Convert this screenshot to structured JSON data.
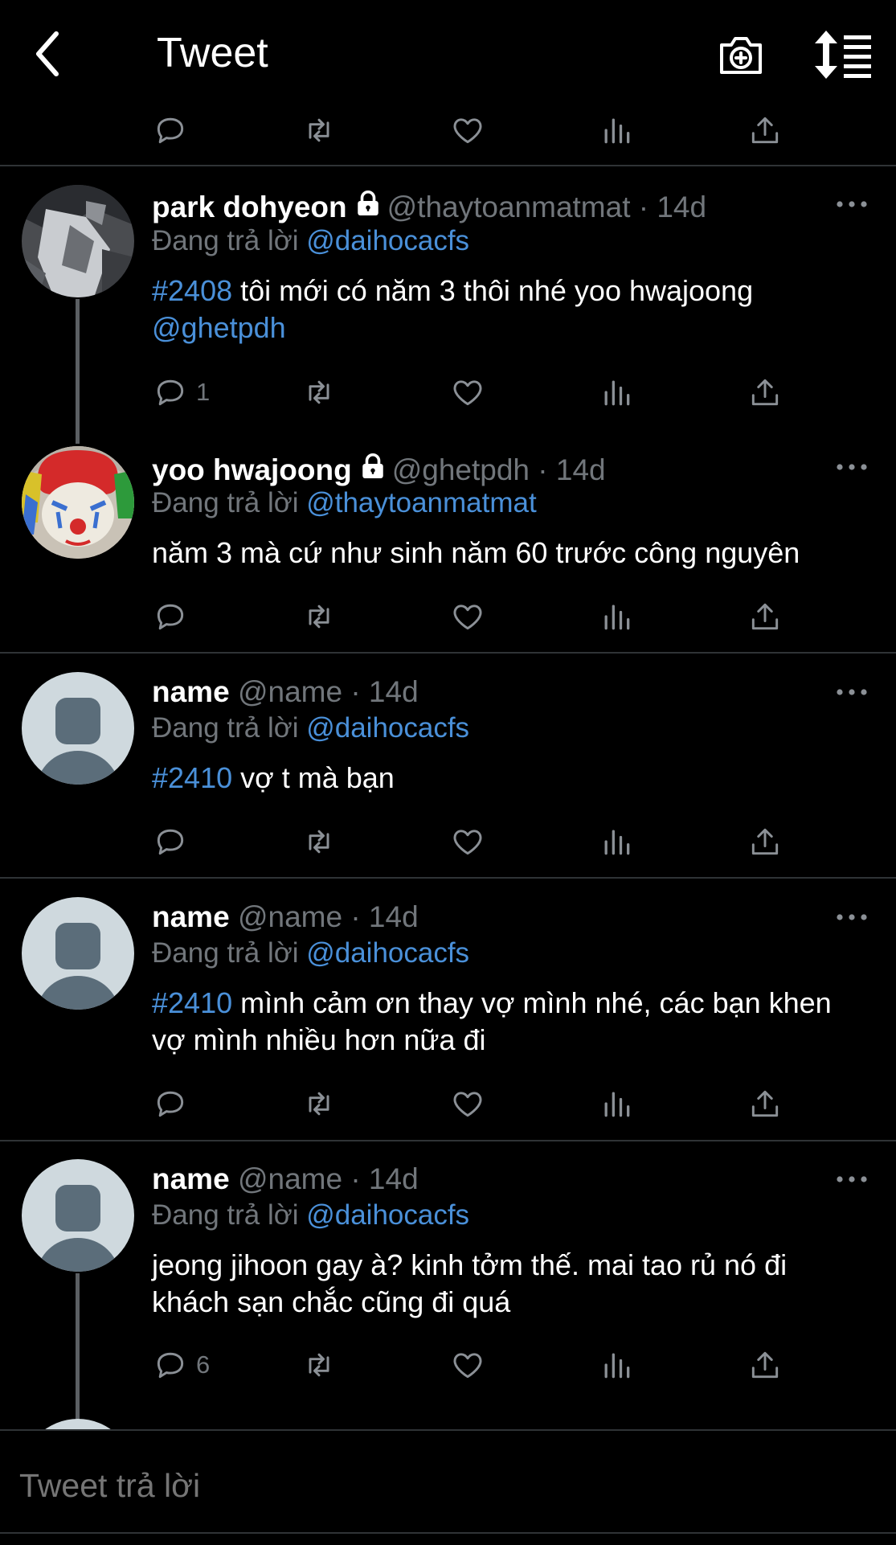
{
  "header": {
    "title": "Tweet"
  },
  "tweets": [
    {
      "name": "park dohyeon",
      "handle_time": "@thaytoanmatmat · 14d",
      "replying_label": "Đang trả lời",
      "replying_to": "@daihocacfs",
      "hashtag": "#2408",
      "text": " tôi mới có năm 3 thôi nhé yoo hwajoong",
      "mention": "@ghetpdh",
      "reply_count": "1"
    },
    {
      "name": "yoo hwajoong",
      "handle_time": "@ghetpdh · 14d",
      "replying_label": "Đang trả lời",
      "replying_to": "@thaytoanmatmat",
      "text": "năm 3 mà cứ như sinh năm 60 trước công nguyên"
    },
    {
      "name": "name",
      "handle_time": "@name · 14d",
      "replying_label": "Đang trả lời",
      "replying_to": "@daihocacfs",
      "hashtag": "#2410",
      "text": " vợ t mà bạn"
    },
    {
      "name": "name",
      "handle_time": "@name · 14d",
      "replying_label": "Đang trả lời",
      "replying_to": "@daihocacfs",
      "hashtag": "#2410",
      "text": " mình cảm ơn thay vợ mình nhé, các bạn khen vợ mình nhiều hơn nữa đi"
    },
    {
      "name": "name",
      "handle_time": "@name · 14d",
      "replying_label": "Đang trả lời",
      "replying_to": "@daihocacfs",
      "text": "jeong jihoon gay à? kinh tởm thế. mai tao rủ nó đi khách sạn chắc cũng đi quá",
      "reply_count": "6"
    }
  ],
  "reply_box": {
    "placeholder": "Tweet trả lời"
  },
  "colors": {
    "background": "#000000",
    "link": "#4a90d9",
    "muted": "#71767b",
    "divider": "#2f3336"
  },
  "icons": [
    "back-arrow-icon",
    "camera-plus-icon",
    "sort-icon",
    "reply-icon",
    "retweet-icon",
    "like-icon",
    "views-icon",
    "share-icon",
    "lock-icon",
    "more-icon"
  ]
}
